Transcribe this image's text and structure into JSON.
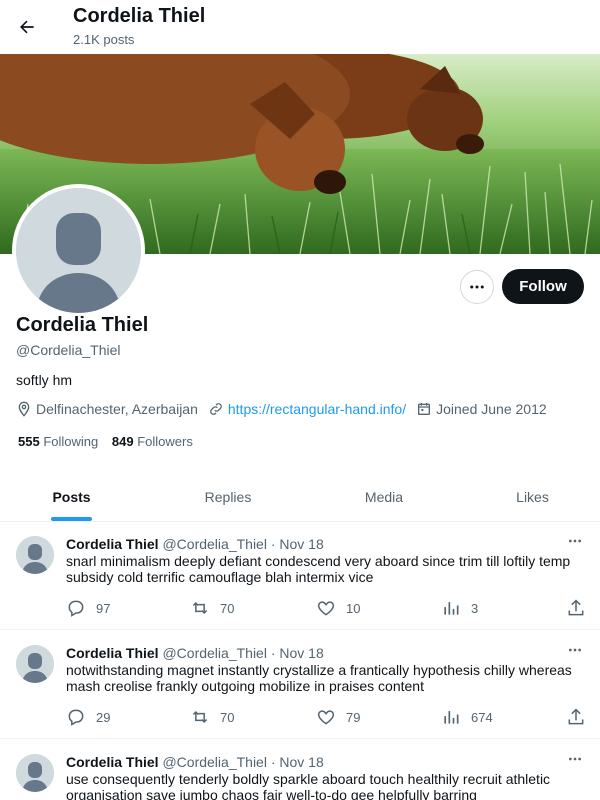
{
  "header": {
    "name": "Cordelia Thiel",
    "posts_count": "2.1K posts"
  },
  "profile": {
    "name": "Cordelia Thiel",
    "handle": "@Cordelia_Thiel",
    "bio": "softly hm",
    "location": "Delfinachester, Azerbaijan",
    "website": "https://rectangular-hand.info/",
    "joined": "Joined June 2012",
    "following_count": "555",
    "following_label": "Following",
    "followers_count": "849",
    "followers_label": "Followers",
    "follow_label": "Follow"
  },
  "tabs": [
    {
      "label": "Posts",
      "active": true
    },
    {
      "label": "Replies",
      "active": false
    },
    {
      "label": "Media",
      "active": false
    },
    {
      "label": "Likes",
      "active": false
    }
  ],
  "tweets": [
    {
      "name": "Cordelia Thiel",
      "handle": "@Cordelia_Thiel",
      "date": "· Nov 18",
      "text": "snarl minimalism deeply defiant condescend very aboard since trim till loftily temp subsidy cold terrific camouflage blah intermix vice",
      "replies": "97",
      "reposts": "70",
      "likes": "10",
      "views": "3"
    },
    {
      "name": "Cordelia Thiel",
      "handle": "@Cordelia_Thiel",
      "date": "· Nov 18",
      "text": "notwithstanding magnet instantly crystallize a frantically hypothesis chilly whereas mash creolise frankly outgoing mobilize in praises content",
      "replies": "29",
      "reposts": "70",
      "likes": "79",
      "views": "674"
    },
    {
      "name": "Cordelia Thiel",
      "handle": "@Cordelia_Thiel",
      "date": "· Nov 18",
      "text": "use consequently tenderly boldly sparkle aboard touch healthily recruit athletic organisation save jumbo chaos fair well-to-do gee helpfully barring",
      "replies": "",
      "reposts": "",
      "likes": "",
      "views": ""
    }
  ],
  "colors": {
    "accent": "#1d9bf0",
    "text": "#0f1419",
    "muted": "#536471",
    "follow_bg": "#0f1419"
  },
  "icons": {
    "back": "arrow-left-icon",
    "more": "more-horizontal-icon",
    "location": "location-pin-icon",
    "link": "link-icon",
    "calendar": "calendar-icon",
    "reply": "reply-icon",
    "repost": "repost-icon",
    "like": "heart-icon",
    "views": "views-icon",
    "share": "share-icon"
  }
}
